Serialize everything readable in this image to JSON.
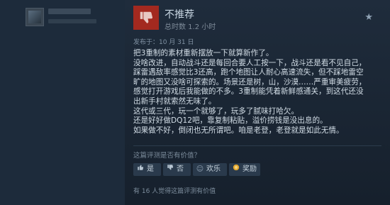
{
  "review": {
    "verdict": "不推荐",
    "hours": "总时数 1.2 小时",
    "posted": "发布于：10 月 31 日",
    "body": [
      "把3重制的素材重新摆放一下就算新作了。",
      "没啥改进，自动战斗还是每回合要人工按一下，战斗还是看不见自己，",
      "踩雷遇敌率感觉比3还高，跑个地图让人耐心高速流失，但不踩地雷空",
      "旷的地图又没啥可探索的。场景还是树，山，沙漠……严重审美疲劳，",
      "感觉打开游戏后我能做的不多。3重制能凭着新鲜感通关，到这代还没",
      "出新手村就索然无味了。",
      "这代或三代，玩一个就够了，玩多了腻味打哈欠。",
      "还是好好做DQ12吧，靠复制粘贴，溢价捞钱是没出息的。",
      "如果做不好，倒闭也无所谓吧。咱是老登，老登就是如此无情。"
    ],
    "helpful_question": "这篇评测是否有价值？",
    "buttons": {
      "yes": "是",
      "no": "否",
      "funny": "欢乐",
      "award": "奖励"
    },
    "helpful_count": "有 16 人觉得这篇评测有价值"
  },
  "icons": {
    "verdict": "thumbs-down-icon",
    "flag": "star-icon"
  },
  "colors": {
    "thumb_bg": "#a3291f",
    "background": "#1b2838"
  }
}
